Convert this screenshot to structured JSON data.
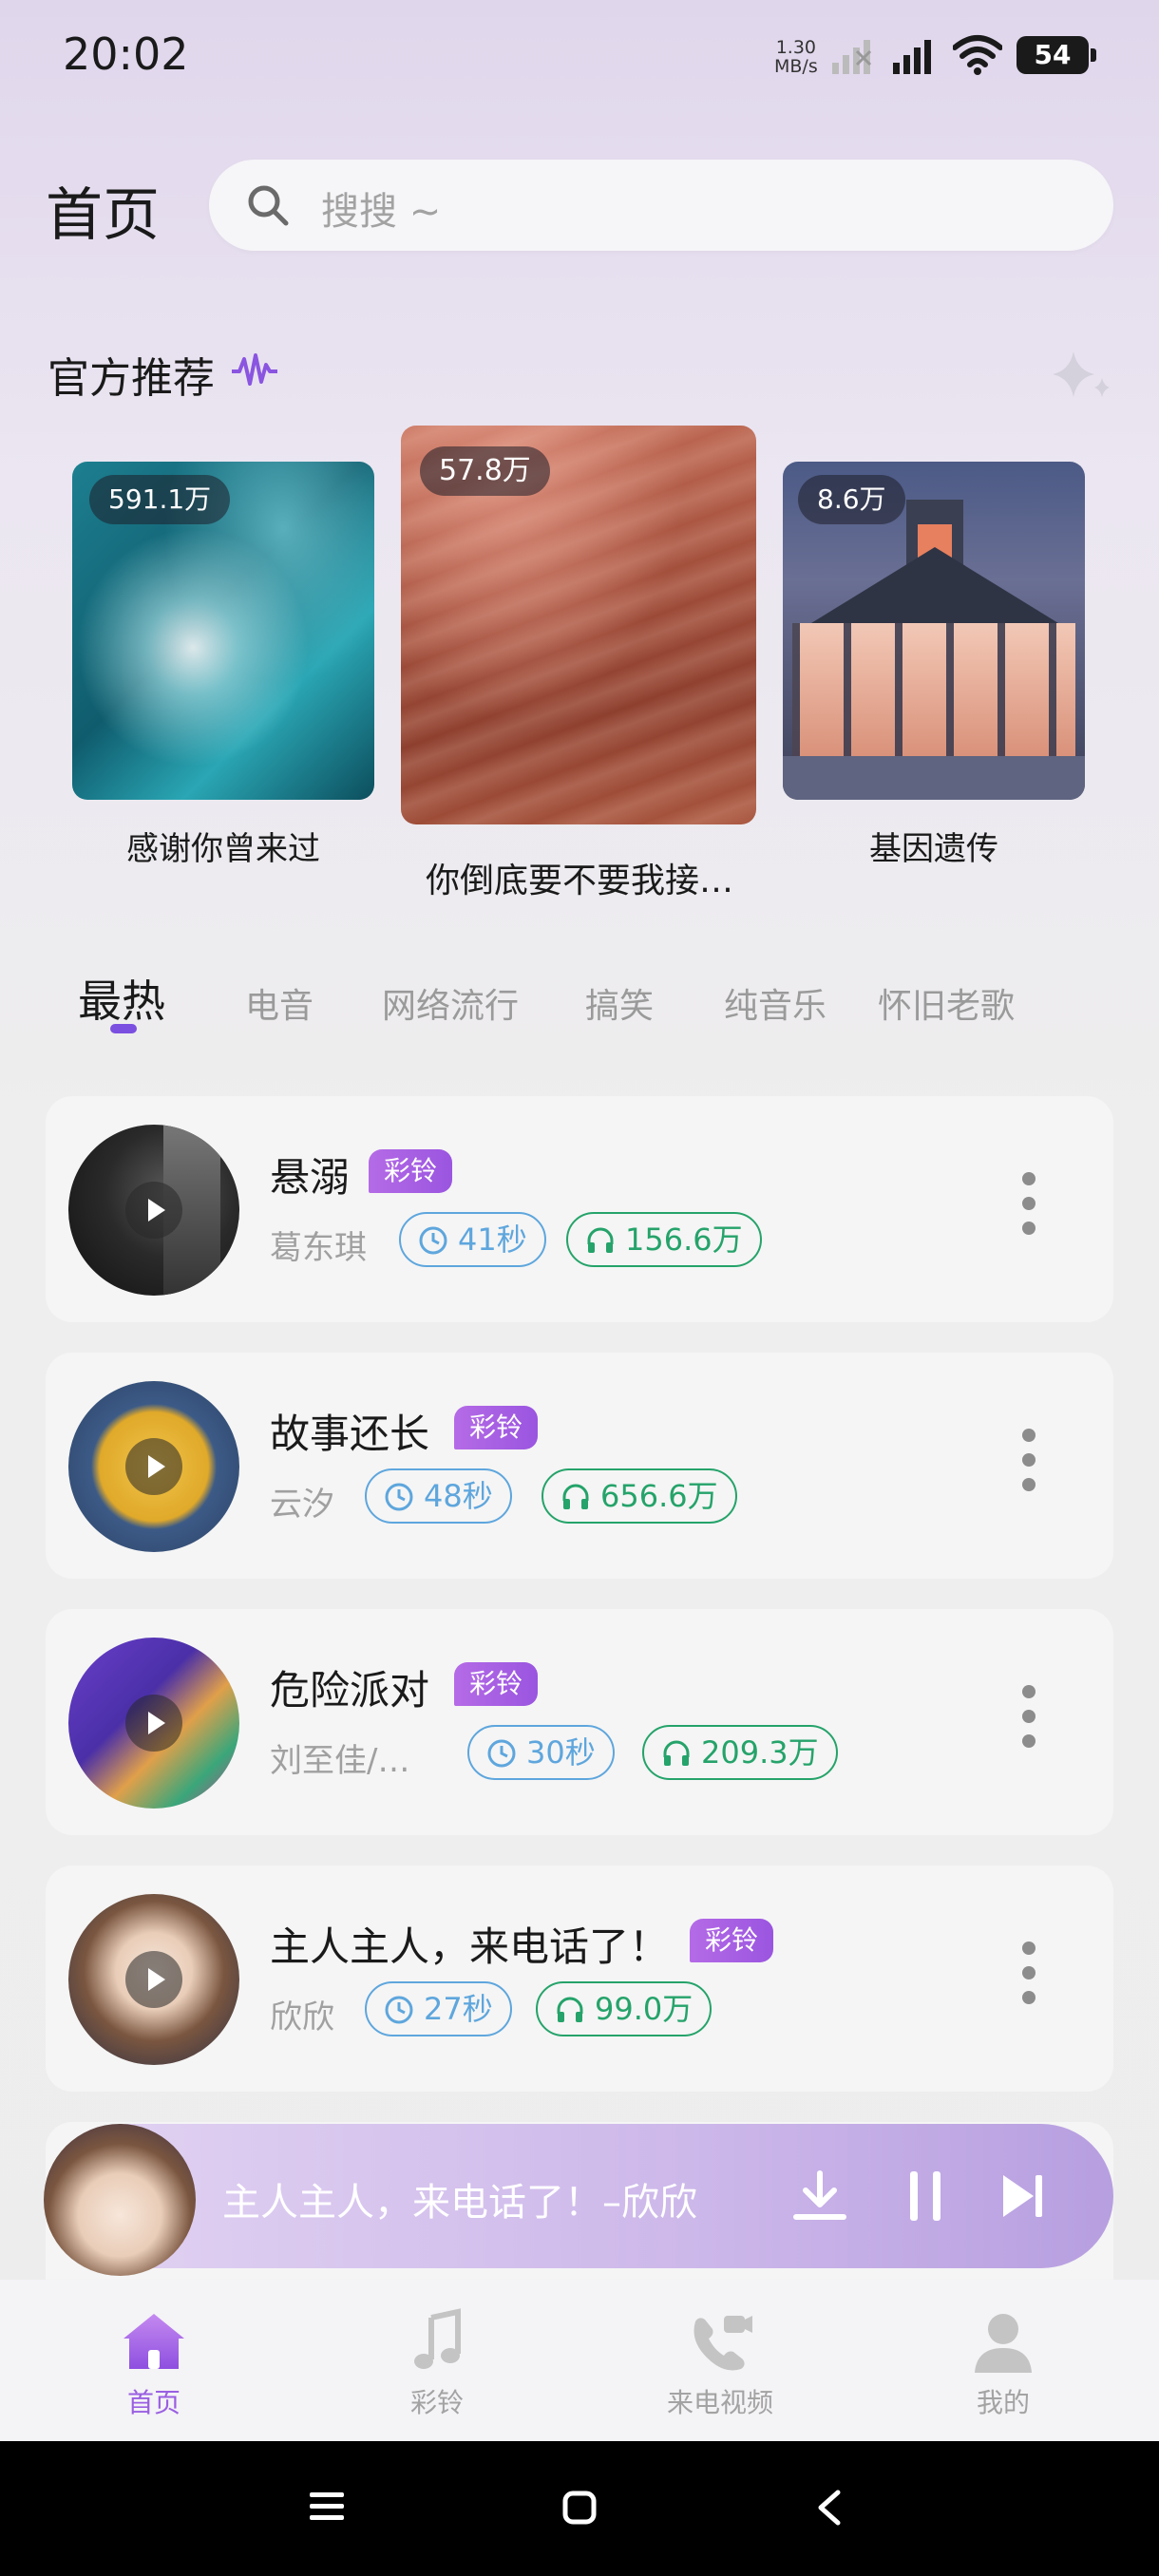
{
  "status_bar": {
    "time": "20:02",
    "net_speed_value": "1.30",
    "net_speed_unit": "MB/s",
    "battery": "54"
  },
  "header": {
    "title": "首页",
    "search_placeholder": "搜搜 ~"
  },
  "recommend": {
    "title": "官方推荐",
    "items": [
      {
        "plays": "591.1万",
        "title": "感谢你曾来过"
      },
      {
        "plays": "57.8万",
        "title": "你倒底要不要我接…"
      },
      {
        "plays": "8.6万",
        "title": "基因遗传"
      }
    ]
  },
  "tabs": [
    "最热",
    "电音",
    "网络流行",
    "搞笑",
    "纯音乐",
    "怀旧老歌"
  ],
  "songs": [
    {
      "title": "悬溺",
      "badge": "彩铃",
      "artist": "葛东琪",
      "duration": "41秒",
      "plays": "156.6万"
    },
    {
      "title": "故事还长",
      "badge": "彩铃",
      "artist": "云汐",
      "duration": "48秒",
      "plays": "656.6万"
    },
    {
      "title": "危险派对",
      "badge": "彩铃",
      "artist": "刘至佳/…",
      "duration": "30秒",
      "plays": "209.3万"
    },
    {
      "title": "主人主人，来电话了！",
      "badge": "彩铃",
      "artist": "欣欣",
      "duration": "27秒",
      "plays": "99.0万"
    }
  ],
  "player": {
    "now_playing": "主人主人，来电话了！–欣欣"
  },
  "bottom_nav": [
    {
      "label": "首页",
      "icon": "home-icon"
    },
    {
      "label": "彩铃",
      "icon": "music-note-icon"
    },
    {
      "label": "来电视频",
      "icon": "phone-video-icon"
    },
    {
      "label": "我的",
      "icon": "user-icon"
    }
  ],
  "colors": {
    "accent": "#9a5fe2",
    "duration_pill": "#5ea6dd",
    "plays_pill": "#25a36a"
  }
}
